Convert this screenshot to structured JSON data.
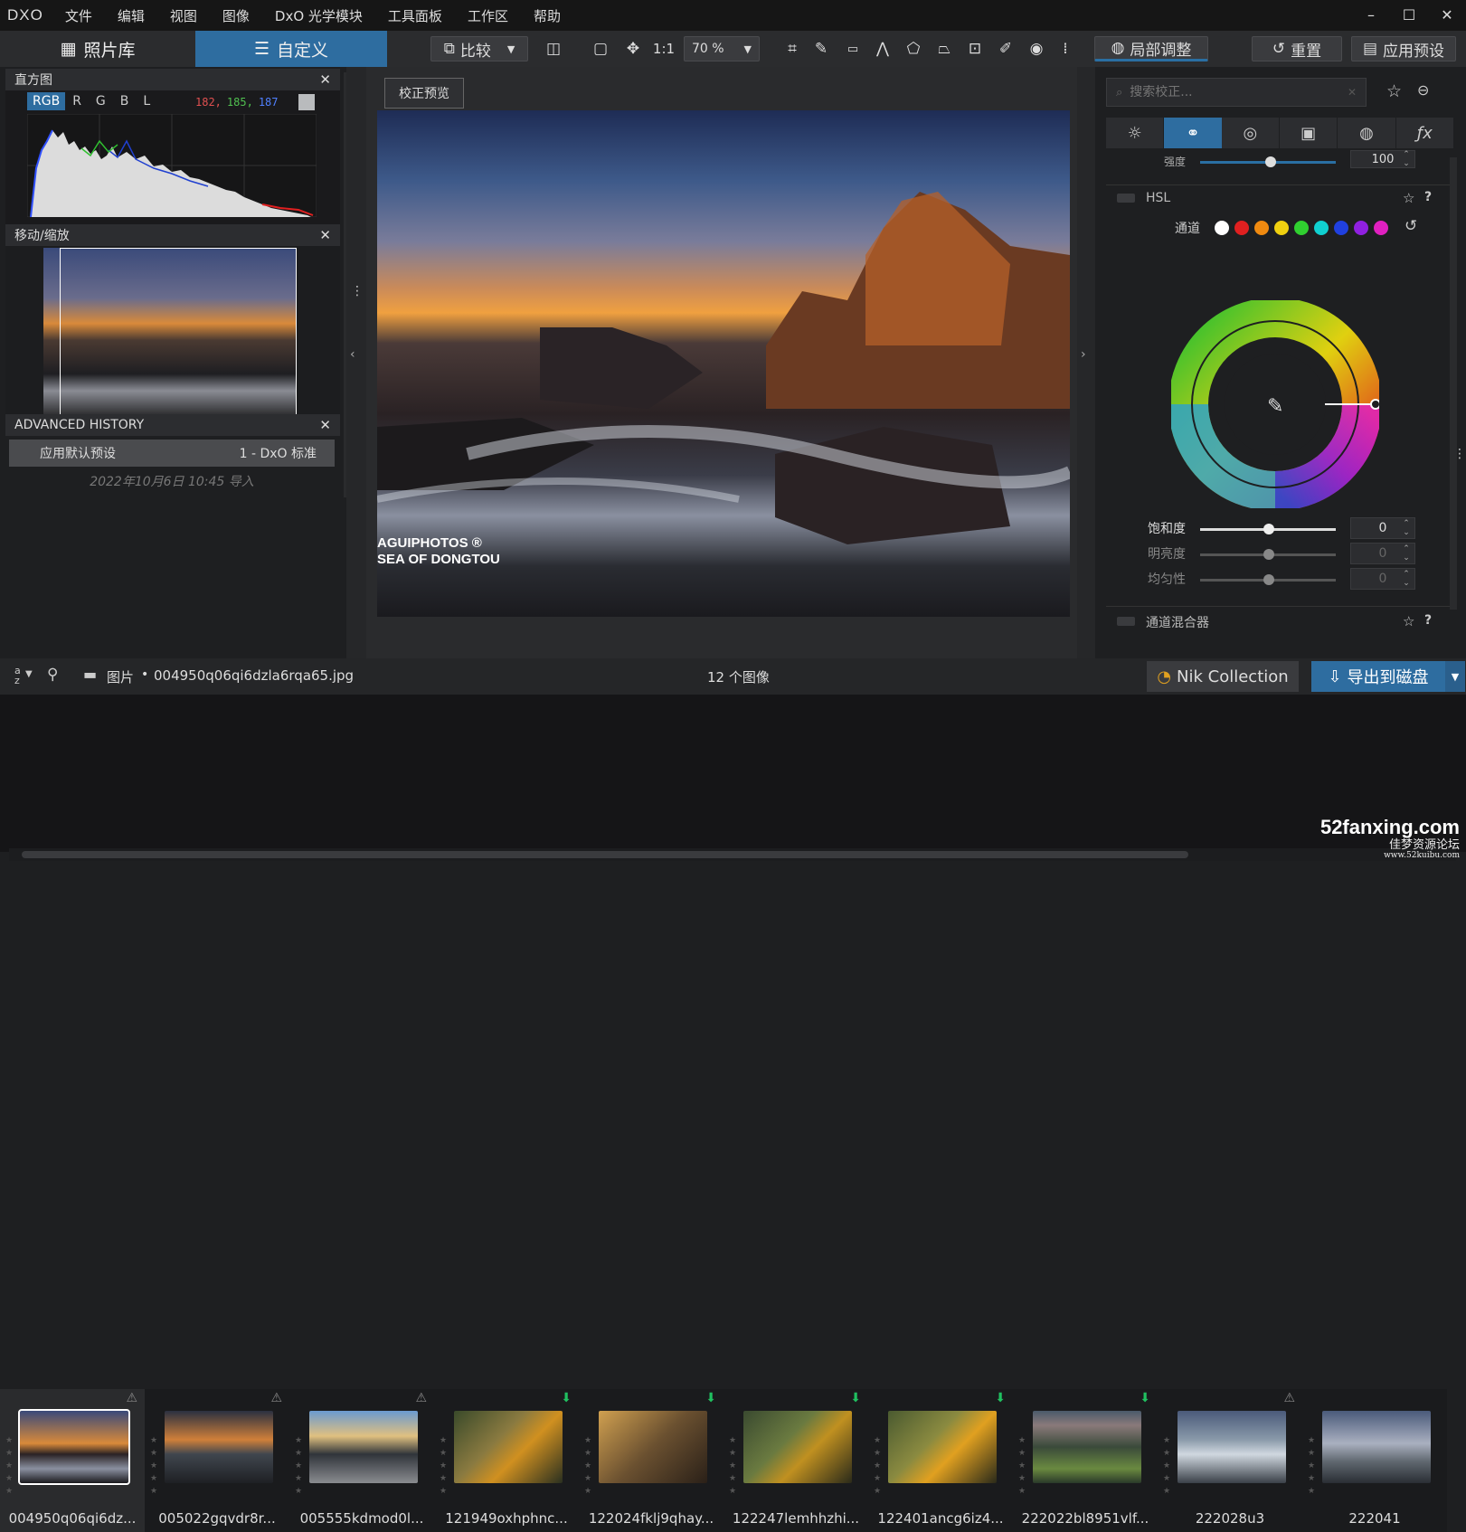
{
  "menu": {
    "logo": "DXO",
    "items": [
      "文件",
      "编辑",
      "视图",
      "图像",
      "DxO 光学模块",
      "工具面板",
      "工作区",
      "帮助"
    ],
    "win": [
      "–",
      "☐",
      "✕"
    ]
  },
  "modes": {
    "library": "照片库",
    "customize": "自定义"
  },
  "toolbar": {
    "compare": "比较",
    "ratio": "1:1",
    "zoom": "70 %",
    "local": "局部调整",
    "reset": "重置",
    "apply_preset": "应用预设"
  },
  "histogram": {
    "title": "直方图",
    "channels": [
      "RGB",
      "R",
      "G",
      "B",
      "L"
    ],
    "r": "182,",
    "g": "185,",
    "b": "187"
  },
  "navigator": {
    "title": "移动/缩放"
  },
  "history": {
    "title": "ADVANCED HISTORY",
    "item_label": "应用默认预设",
    "item_value": "1 - DxO 标准",
    "date": "2022年10月6日 10:45 导入"
  },
  "viewer": {
    "preview_btn": "校正预览",
    "watermark1": "AGUIPHOTOS ®",
    "watermark2": "SEA OF DONGTOU"
  },
  "right": {
    "search_placeholder": "搜索校正...",
    "strength_label": "强度",
    "strength_value": "100",
    "hsl_title": "HSL",
    "channel_label": "通道",
    "saturation": "饱和度",
    "saturation_value": "0",
    "brightness": "明亮度",
    "brightness_value": "0",
    "uniformity": "均匀性",
    "uniformity_value": "0",
    "mixer": "通道混合器"
  },
  "bottom": {
    "sort": "a z",
    "folder": "图片",
    "sep": "•",
    "filename": "004950q06qi6dzla6rqa65.jpg",
    "count": "12 个图像",
    "nik": "Nik Collection",
    "export": "导出到磁盘"
  },
  "thumbs": [
    {
      "name": "004950q06qi6dz...",
      "badge": "warn"
    },
    {
      "name": "005022gqvdr8r...",
      "badge": "warn"
    },
    {
      "name": "005555kdmod0l...",
      "badge": "warn"
    },
    {
      "name": "121949oxhphnc...",
      "badge": "ok"
    },
    {
      "name": "122024fklj9qhay...",
      "badge": "ok"
    },
    {
      "name": "122247lemhhzhi...",
      "badge": "ok"
    },
    {
      "name": "122401ancg6iz4...",
      "badge": "ok"
    },
    {
      "name": "222022bl8951vlf...",
      "badge": "ok"
    },
    {
      "name": "222028u3",
      "badge": "warn"
    },
    {
      "name": "222041",
      "badge": ""
    }
  ],
  "watermark": {
    "brand": "52fanxing.com",
    "sub": "佳梦资源论坛",
    "url": "www.52kuibu.com"
  },
  "colors": {
    "accent": "#2a6fa3",
    "active_tab": "#2e6da0",
    "hsl_dots": [
      "#ffffff",
      "#e02020",
      "#f08a10",
      "#f0d010",
      "#30d030",
      "#10d0d0",
      "#2040e0",
      "#9020e0",
      "#e020c0"
    ]
  }
}
